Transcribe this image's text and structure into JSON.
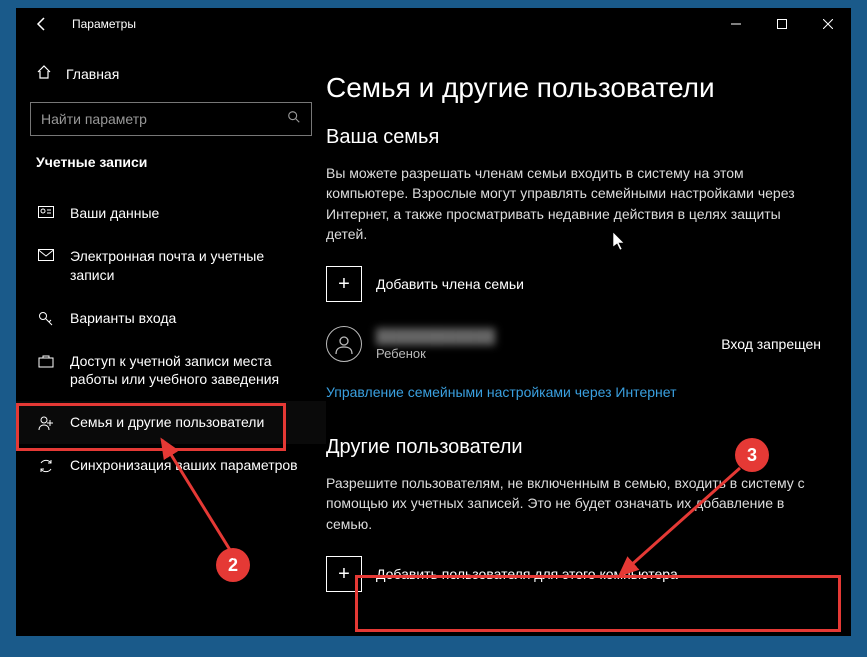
{
  "window": {
    "title": "Параметры"
  },
  "sidebar": {
    "home": "Главная",
    "search_placeholder": "Найти параметр",
    "category": "Учетные записи",
    "items": [
      {
        "label": "Ваши данные"
      },
      {
        "label": "Электронная почта и учетные записи"
      },
      {
        "label": "Варианты входа"
      },
      {
        "label": "Доступ к учетной записи места работы или учебного заведения"
      },
      {
        "label": "Семья и другие пользователи"
      },
      {
        "label": "Синхронизация ваших параметров"
      }
    ]
  },
  "content": {
    "page_title": "Семья и другие пользователи",
    "family_heading": "Ваша семья",
    "family_desc": "Вы можете разрешать членам семьи входить в систему на этом компьютере. Взрослые могут управлять семейными настройками через Интернет, а также просматривать недавние действия в целях защиты детей.",
    "add_family": "Добавить члена семьи",
    "member": {
      "name": "████████████",
      "role": "Ребенок",
      "status": "Вход запрещен"
    },
    "manage_link": "Управление семейными настройками через Интернет",
    "others_heading": "Другие пользователи",
    "others_desc": "Разрешите пользователям, не включенным в семью, входить в систему с помощью их учетных записей. Это не будет означать их добавление в семью.",
    "add_other": "Добавить пользователя для этого компьютера"
  },
  "annotations": {
    "step2": "2",
    "step3": "3"
  }
}
